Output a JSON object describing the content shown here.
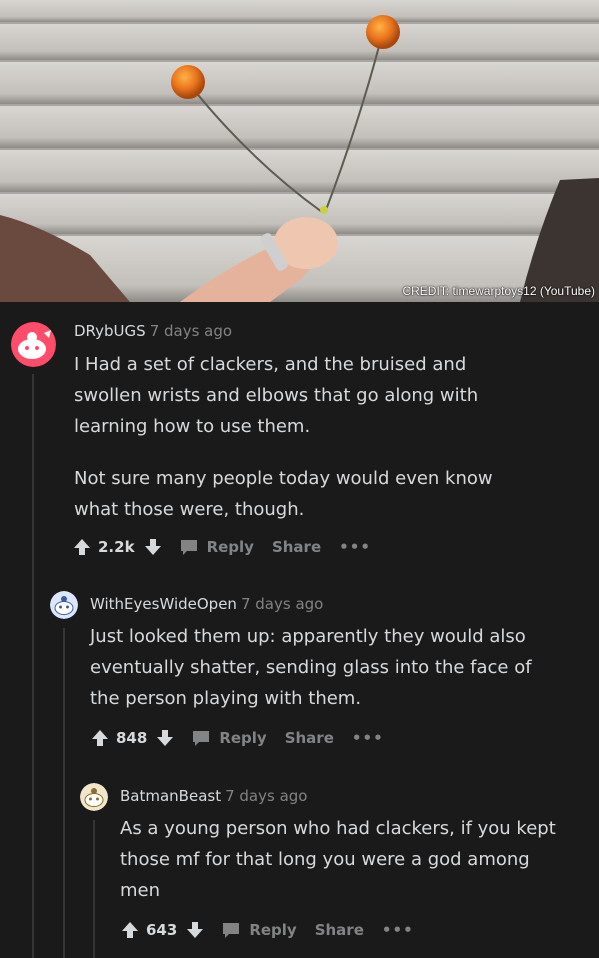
{
  "photo": {
    "credit": "CREDIT: timewarptoys12 (YouTube)"
  },
  "comments": [
    {
      "username": "DRybUGS",
      "time": "7 days ago",
      "paragraphs": [
        "I Had a set of clackers, and the bruised and swollen wrists and elbows that go along with learning how to use them.",
        "Not sure many people today would even know what those were, though."
      ],
      "votes": "2.2k",
      "reply_label": "Reply",
      "share_label": "Share",
      "more_label": "•••"
    },
    {
      "username": "WithEyesWideOpen",
      "time": "7 days ago",
      "paragraphs": [
        "Just looked them up: apparently they would also eventually shatter, sending glass into the face of the person playing with them."
      ],
      "votes": "848",
      "reply_label": "Reply",
      "share_label": "Share",
      "more_label": "•••"
    },
    {
      "username": "BatmanBeast",
      "time": "7 days ago",
      "paragraphs": [
        "As a young person who had clackers, if you kept those mf for that long you were a god among men"
      ],
      "votes": "643",
      "reply_label": "Reply",
      "share_label": "Share",
      "more_label": "•••"
    }
  ],
  "colors": {
    "background": "#1a1a1b",
    "text": "#d7dadc",
    "muted": "#818384",
    "avatar_red": "#ff4c6a"
  },
  "icons": [
    "upvote-icon",
    "downvote-icon",
    "comment-bubble-icon",
    "snoo-avatar-icon"
  ]
}
